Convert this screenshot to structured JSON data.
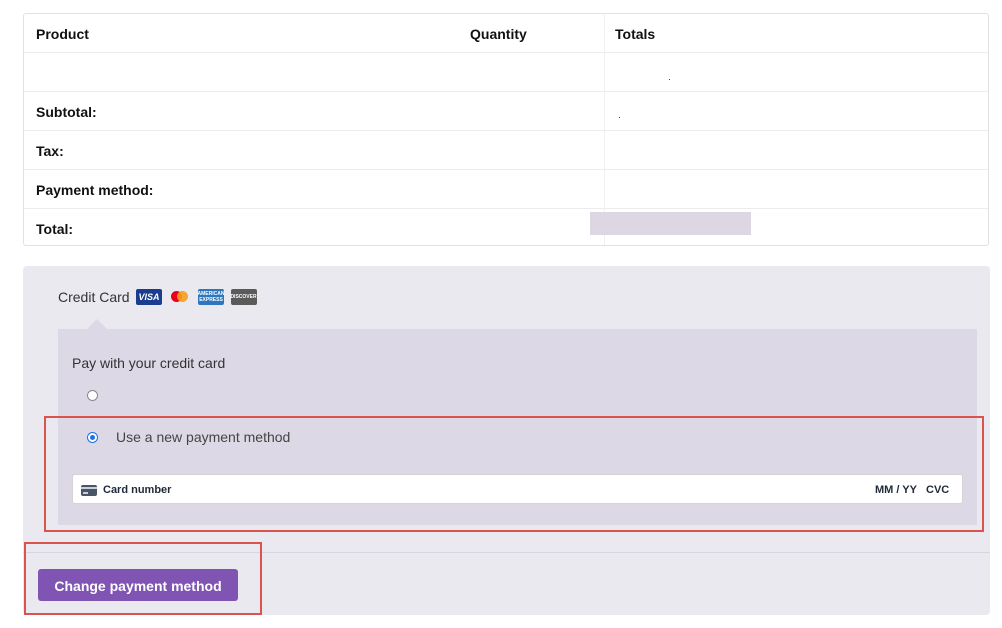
{
  "order_table": {
    "headers": {
      "product": "Product",
      "quantity": "Quantity",
      "totals": "Totals"
    },
    "rows": {
      "subtotal_label": "Subtotal:",
      "tax_label": "Tax:",
      "payment_method_label": "Payment method:",
      "total_label": "Total:"
    }
  },
  "payment": {
    "method_name": "Credit Card",
    "card_logos": {
      "visa": "VISA",
      "amex": "AMERICAN EXPRESS",
      "discover": "DISCOVER"
    },
    "title": "Pay with your credit card",
    "new_method_label": "Use a new payment method",
    "selected": "new",
    "card_field": {
      "number_placeholder": "Card number",
      "expiry_placeholder": "MM / YY",
      "cvc_placeholder": "CVC"
    },
    "submit_label": "Change payment method"
  },
  "colors": {
    "accent": "#7f54b3",
    "panel": "#ebe9f0",
    "inner_panel": "#ddd8e5",
    "annotation": "#d9534f",
    "radio": "#1a73e8"
  },
  "icons": [
    "visa-icon",
    "mastercard-icon",
    "amex-icon",
    "discover-icon",
    "credit-card-icon"
  ]
}
